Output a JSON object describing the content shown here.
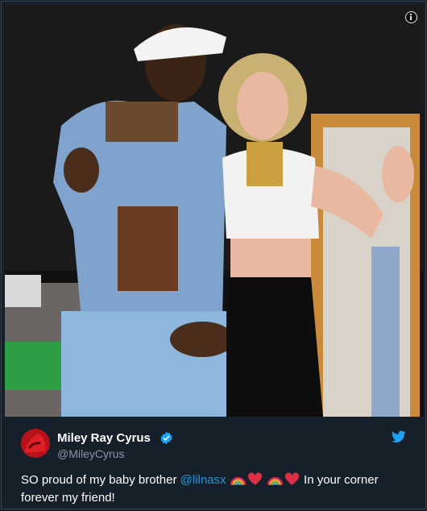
{
  "tweet": {
    "author_name": "Miley Ray Cyrus",
    "author_handle": "@MileyCyrus",
    "text_before": "SO proud of my baby brother ",
    "mention": "@lilnasx",
    "text_after": " In your corner forever my friend!",
    "emojis": [
      "rainbow-emoji",
      "heart-emoji",
      "rainbow-emoji",
      "heart-emoji"
    ]
  },
  "colors": {
    "background": "#15202b",
    "text": "#ffffff",
    "secondary_text": "#8899a6",
    "link": "#1b95e0",
    "verified_badge": "#1da1f2",
    "twitter_bird": "#1da1f2"
  }
}
